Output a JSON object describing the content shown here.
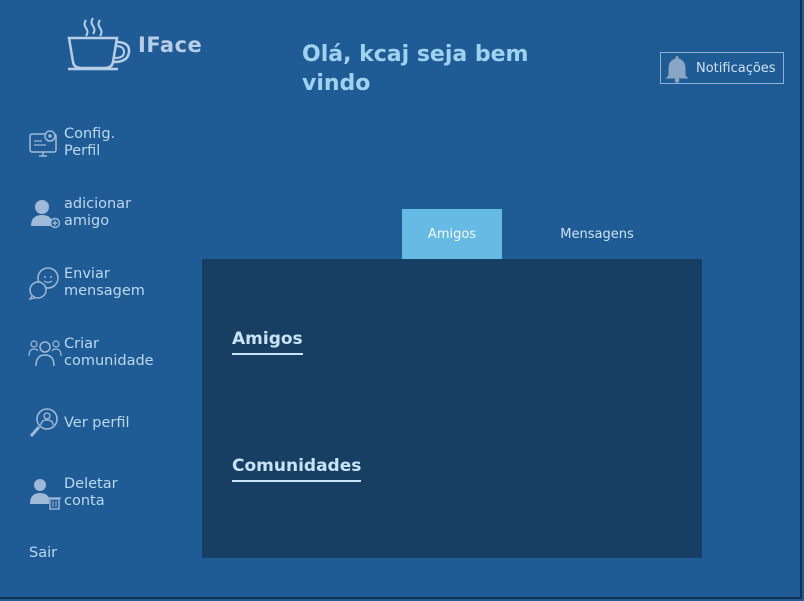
{
  "app": {
    "name": "IFace"
  },
  "header": {
    "greeting": "Olá, kcaj seja bem vindo",
    "notifications_label": "Notificações"
  },
  "sidebar": {
    "items": [
      {
        "label": "Config.\nPerfil",
        "icon": "settings-profile-icon"
      },
      {
        "label": "adicionar\namigo",
        "icon": "add-user-icon"
      },
      {
        "label": "Enviar\nmensagem",
        "icon": "chat-icon"
      },
      {
        "label": "Criar\ncomunidade",
        "icon": "community-icon"
      },
      {
        "label": "Ver perfil",
        "icon": "view-profile-icon"
      },
      {
        "label": "Deletar\nconta",
        "icon": "delete-account-icon"
      }
    ],
    "logout_label": "Sair"
  },
  "tabs": [
    {
      "label": "Amigos",
      "active": true
    },
    {
      "label": "Mensagens",
      "active": false
    }
  ],
  "panel": {
    "friends_title": "Amigos",
    "communities_title": "Comunidades"
  },
  "colors": {
    "background": "#1f5c96",
    "panel": "#173e63",
    "active_tab": "#66bbe4",
    "accent_text": "#9fd2ee"
  }
}
